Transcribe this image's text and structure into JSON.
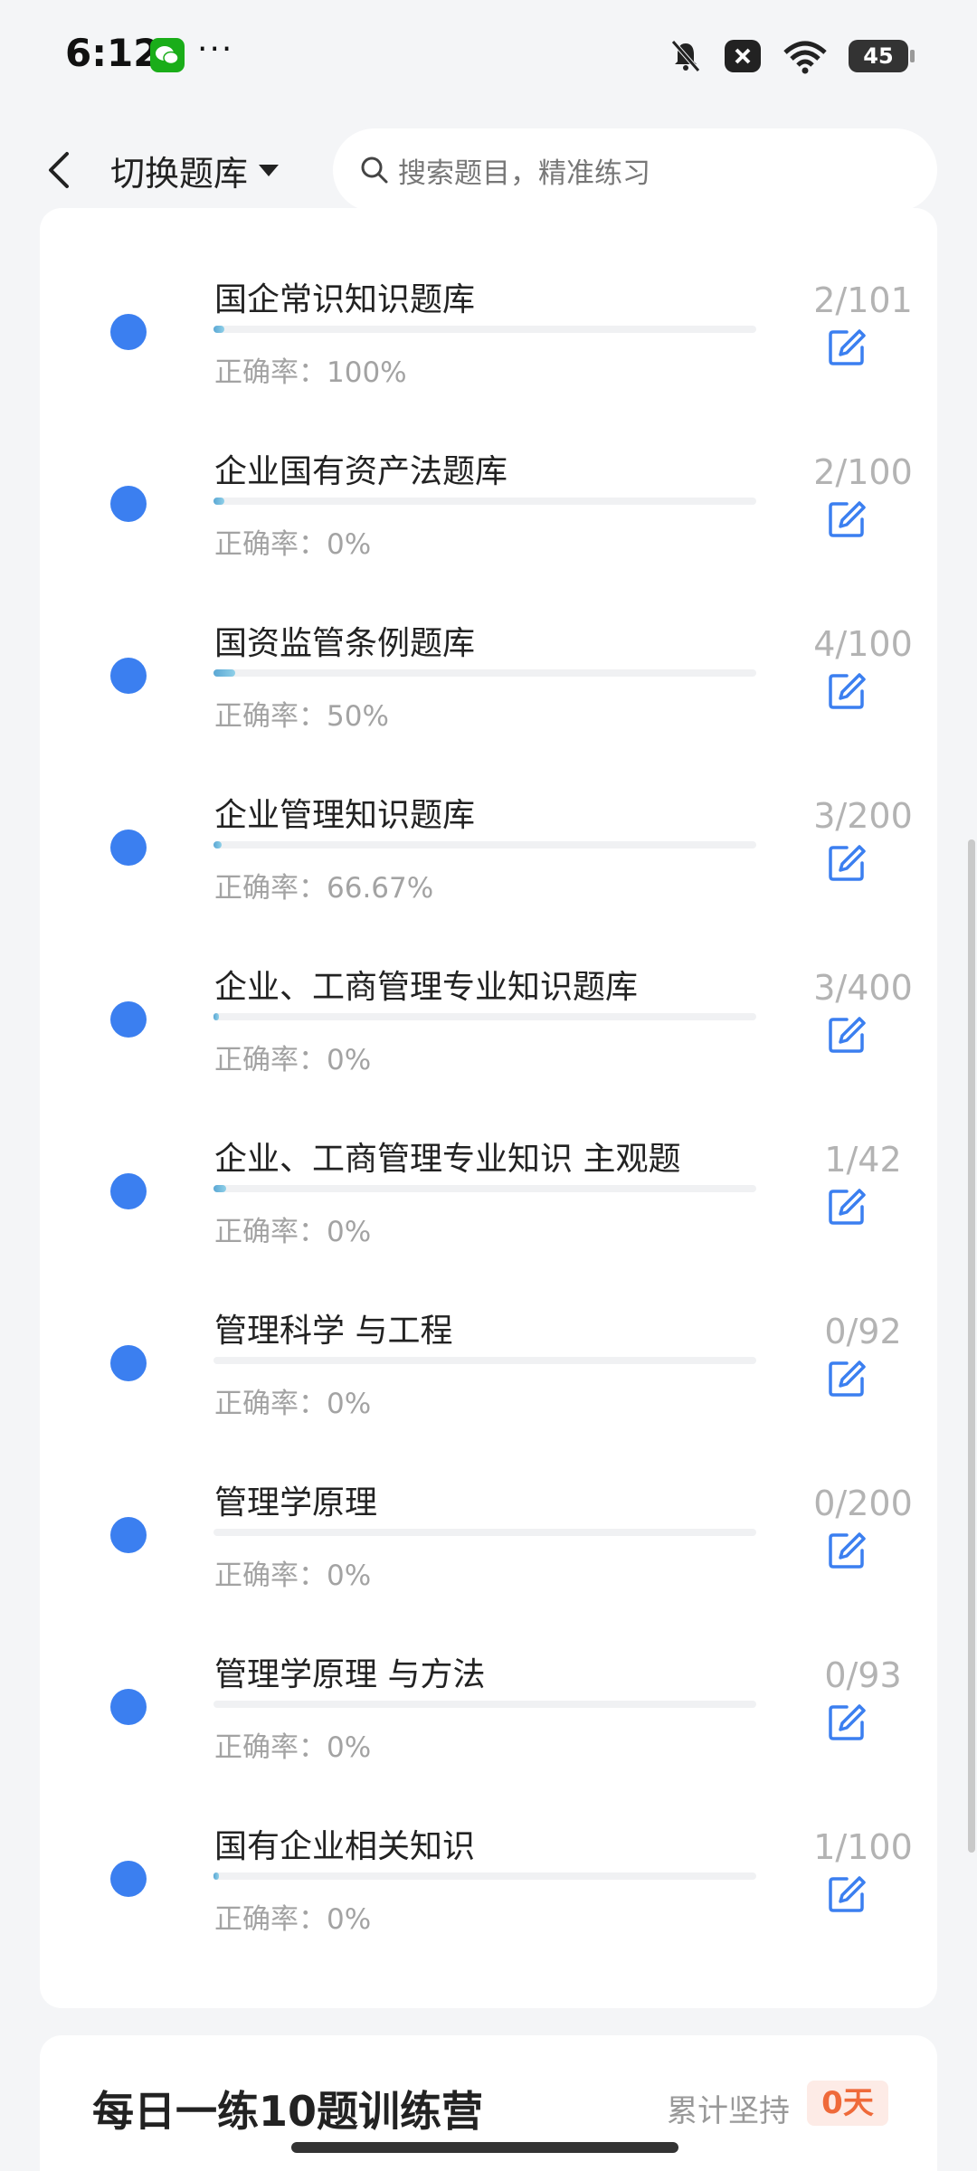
{
  "status_bar": {
    "time": "6:12",
    "more": "···",
    "battery": "45",
    "icons": [
      "wechat-icon",
      "bell-off-icon",
      "close-box-icon",
      "wifi-icon",
      "battery-icon"
    ]
  },
  "header": {
    "switch_label": "切换题库",
    "search_placeholder": "搜索题目，精准练习"
  },
  "accent_color": "#3b7ff0",
  "items": [
    {
      "title": "国企常识知识题库",
      "accuracy": "正确率：100%",
      "count": "2/101",
      "progress": 0.0198
    },
    {
      "title": "企业国有资产法题库",
      "accuracy": "正确率：0%",
      "count": "2/100",
      "progress": 0.02
    },
    {
      "title": "国资监管条例题库",
      "accuracy": "正确率：50%",
      "count": "4/100",
      "progress": 0.04
    },
    {
      "title": "企业管理知识题库",
      "accuracy": "正确率：66.67%",
      "count": "3/200",
      "progress": 0.015
    },
    {
      "title": "企业、工商管理专业知识题库",
      "accuracy": "正确率：0%",
      "count": "3/400",
      "progress": 0.0075
    },
    {
      "title": "企业、工商管理专业知识 主观题",
      "accuracy": "正确率：0%",
      "count": "1/42",
      "progress": 0.0238
    },
    {
      "title": "管理科学 与工程",
      "accuracy": "正确率：0%",
      "count": "0/92",
      "progress": 0
    },
    {
      "title": "管理学原理",
      "accuracy": "正确率：0%",
      "count": "0/200",
      "progress": 0
    },
    {
      "title": "管理学原理 与方法",
      "accuracy": "正确率：0%",
      "count": "0/93",
      "progress": 0
    },
    {
      "title": "国有企业相关知识",
      "accuracy": "正确率：0%",
      "count": "1/100",
      "progress": 0.01
    }
  ],
  "camp": {
    "title": "每日一练10题训练营",
    "streak_label": "累计坚持",
    "streak_value": "0天"
  }
}
